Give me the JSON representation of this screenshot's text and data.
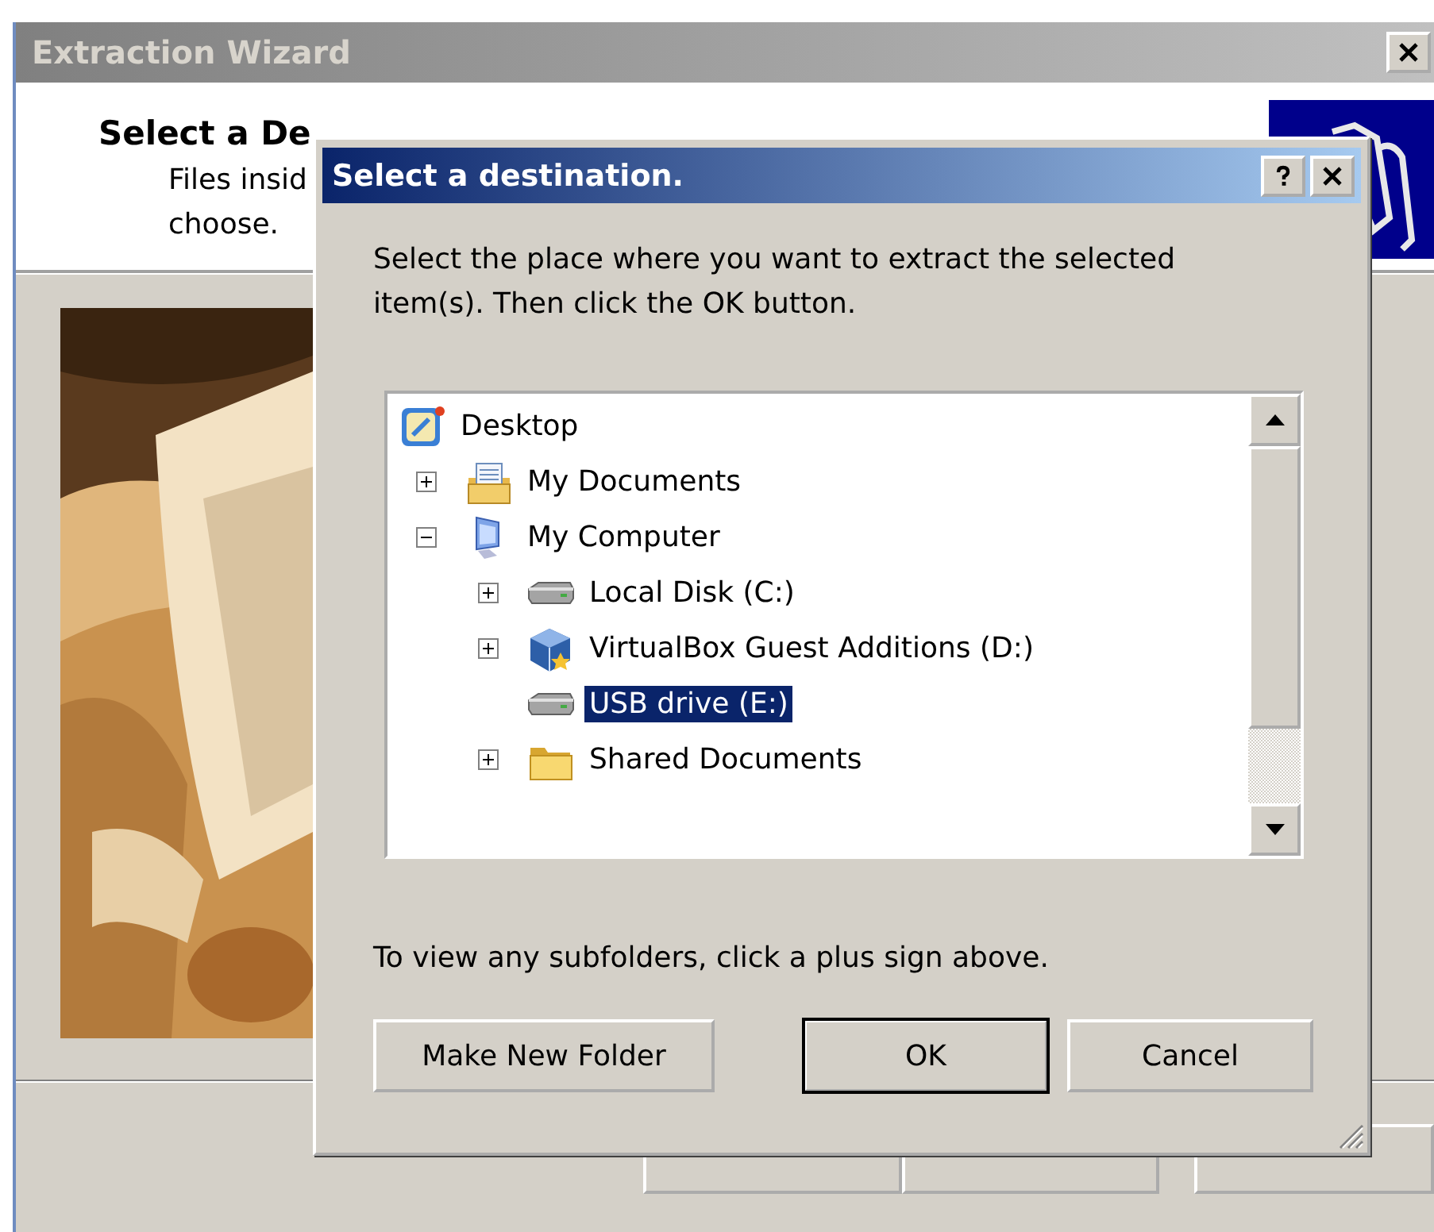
{
  "wizard": {
    "title": "Extraction Wizard",
    "heading": "Select a De",
    "description_lines": [
      "Files insid",
      "choose."
    ]
  },
  "dialog": {
    "title": "Select a destination.",
    "instructions": "Select the place where you want to extract the selected item(s).  Then click the OK button.",
    "tree": [
      {
        "label": "Desktop",
        "kind": "desktop",
        "selected": false,
        "children": [
          {
            "label": "My Documents",
            "kind": "documents",
            "expanded": false,
            "selected": false
          },
          {
            "label": "My Computer",
            "kind": "computer",
            "expanded": true,
            "selected": false,
            "children": [
              {
                "label": "Local Disk (C:)",
                "kind": "disk",
                "expanded": false,
                "selected": false
              },
              {
                "label": "VirtualBox Guest Additions (D:)",
                "kind": "cdrom",
                "expanded": false,
                "selected": false
              },
              {
                "label": "USB drive (E:)",
                "kind": "disk",
                "selected": true
              },
              {
                "label": "Shared Documents",
                "kind": "folder",
                "expanded": false,
                "selected": false
              }
            ]
          }
        ]
      }
    ],
    "hint": "To view any subfolders, click a plus sign above.",
    "buttons": [
      {
        "label": "Make New Folder",
        "default": false
      },
      {
        "label": "OK",
        "default": true
      },
      {
        "label": "Cancel",
        "default": false
      }
    ]
  }
}
